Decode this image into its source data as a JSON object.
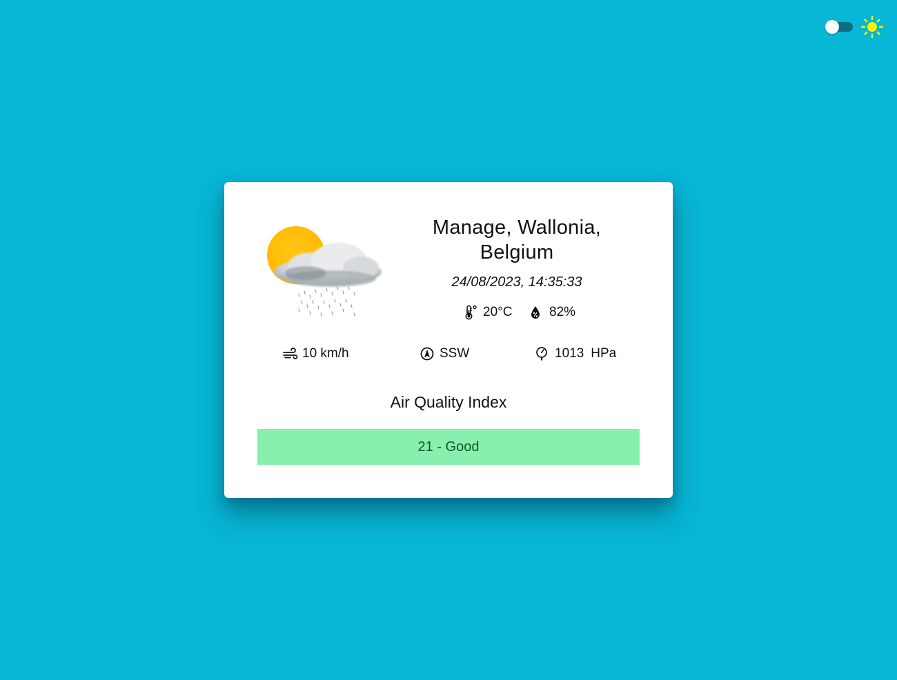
{
  "theme": {
    "toggle_state": "off",
    "mode_icon": "sun-icon",
    "sun_color": "#f5f500"
  },
  "weather": {
    "condition_icon": "partly-cloudy-rain-icon",
    "location": "Manage, Wallonia, Belgium",
    "datetime": "24/08/2023, 14:35:33",
    "temperature": "20°C",
    "humidity": "82%",
    "wind_speed": "10 km/h",
    "wind_direction": "SSW",
    "pressure_value": "1013",
    "pressure_unit": "HPa"
  },
  "air_quality": {
    "title": "Air Quality Index",
    "value_label": "21 - Good",
    "level_color": "#88f0ae"
  },
  "colors": {
    "background": "#08b6d6",
    "card": "#ffffff"
  }
}
